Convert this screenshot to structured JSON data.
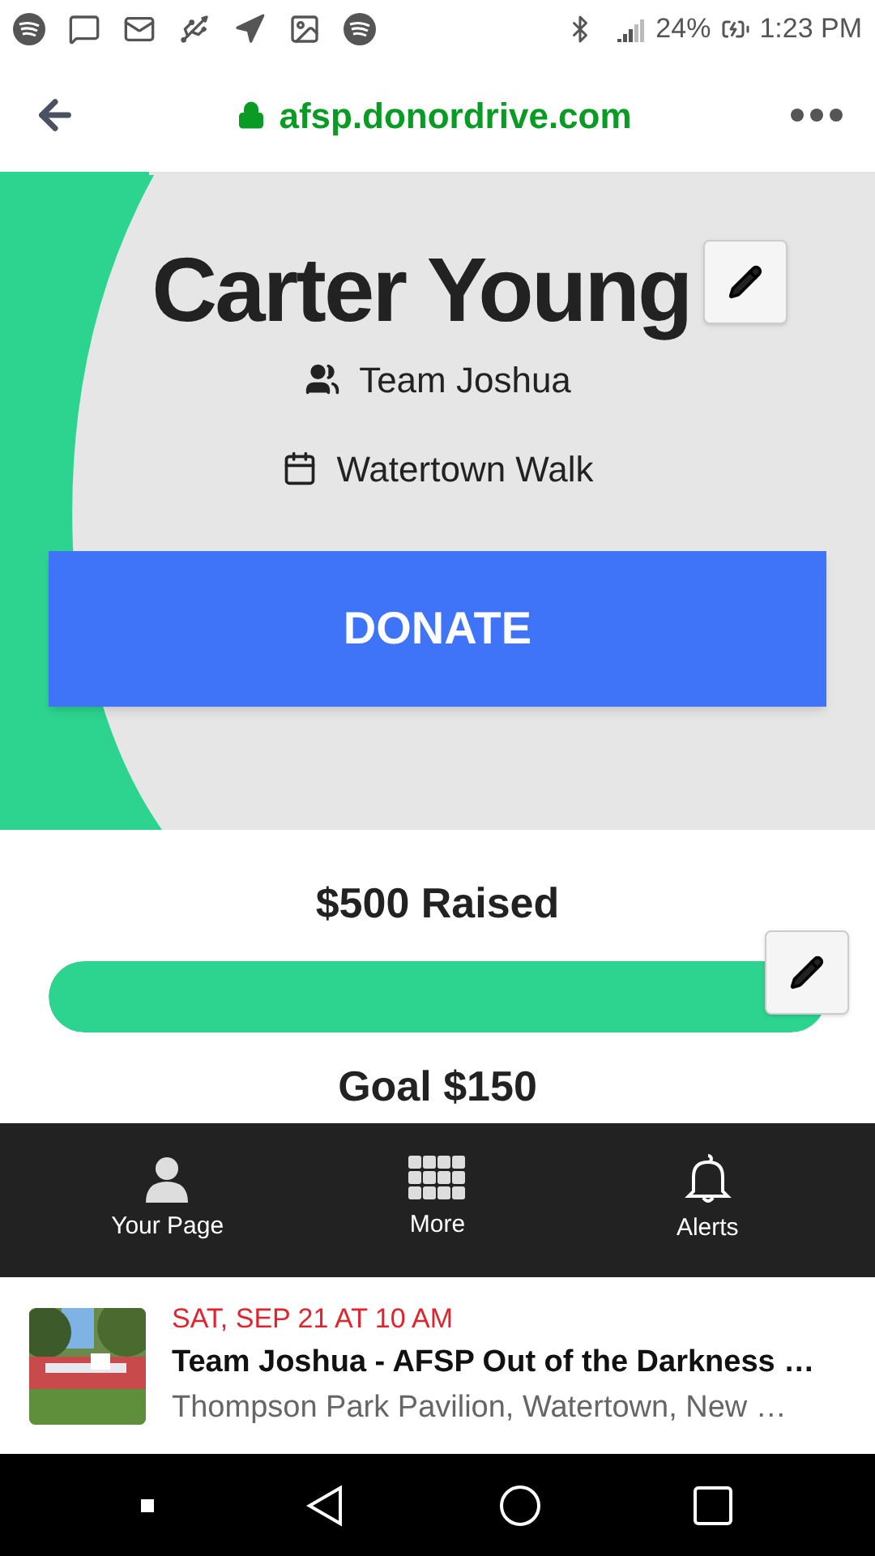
{
  "status_bar": {
    "battery": "24%",
    "time": "1:23 PM"
  },
  "browser": {
    "url": "afsp.donordrive.com",
    "load_progress": {
      "level": 0.17
    }
  },
  "profile": {
    "name": "Carter Young",
    "team": "Team Joshua",
    "event": "Watertown Walk",
    "donate_button": "DONATE"
  },
  "fundraising": {
    "raised": "$500 Raised",
    "progress": {
      "level": 1
    },
    "goal": "Goal $150"
  },
  "tabs": [
    {
      "label": "Your Page",
      "kind": "person",
      "selected": false
    },
    {
      "label": "More",
      "kind": "grid",
      "selected": false
    },
    {
      "label": "Alerts",
      "kind": "bell",
      "selected": false
    }
  ],
  "notification": {
    "date": "SAT, SEP 21 AT 10 AM",
    "title": "Team Joshua - AFSP Out of the Darkness …",
    "location": "Thompson Park Pavilion, Watertown, New …"
  }
}
